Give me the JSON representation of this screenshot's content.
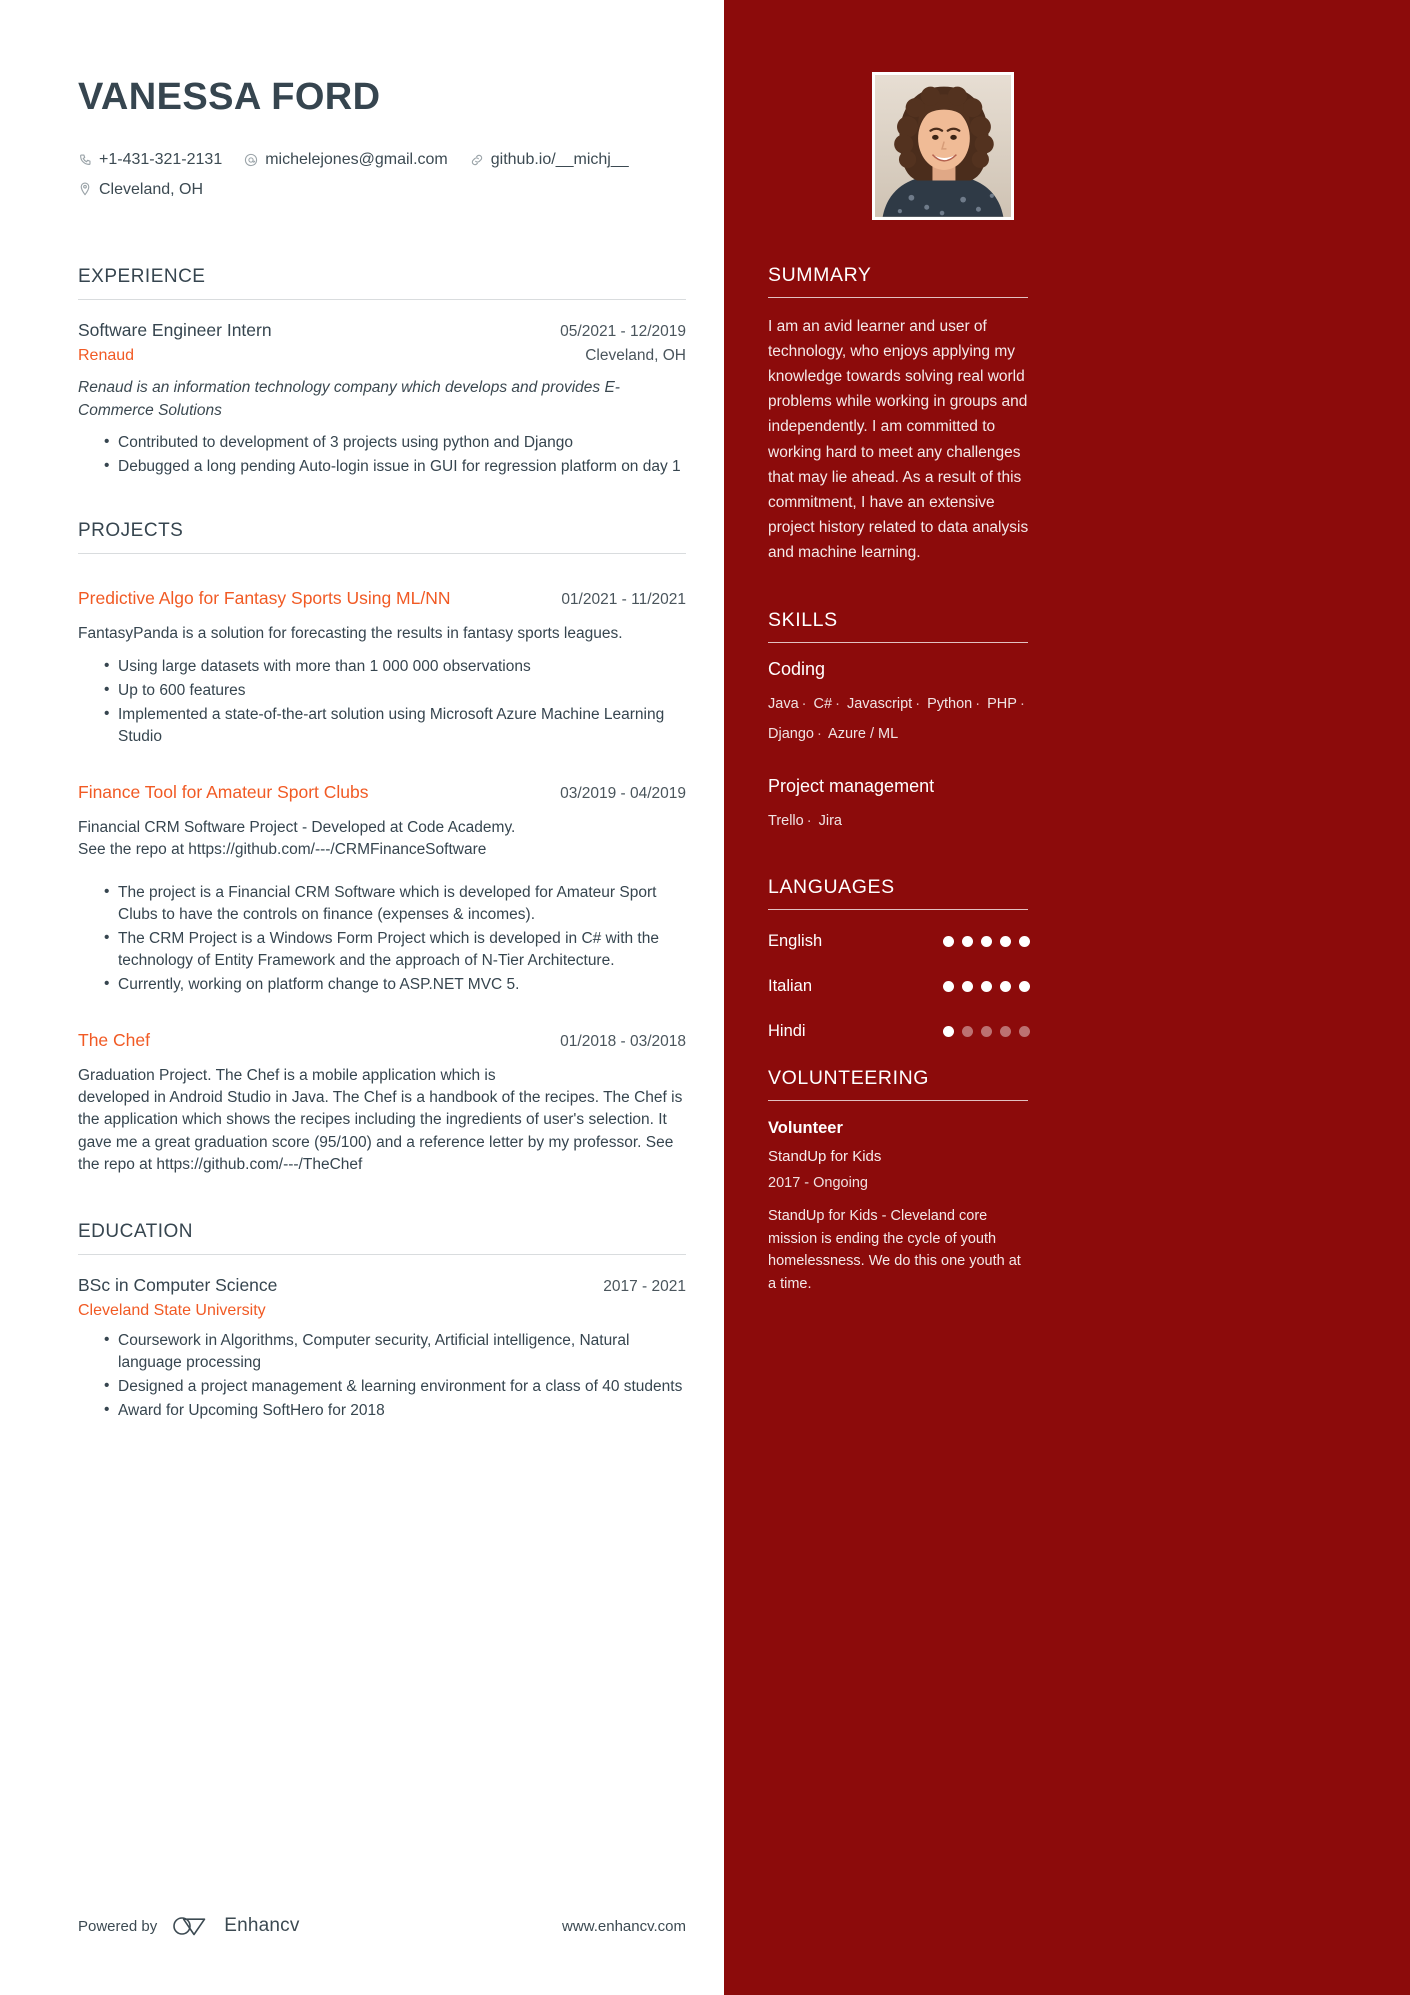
{
  "header": {
    "name": "VANESSA FORD",
    "contacts": [
      {
        "icon": "phone-icon",
        "text": "+1-431-321-2131"
      },
      {
        "icon": "email-icon",
        "text": "michelejones@gmail.com"
      },
      {
        "icon": "link-icon",
        "text": "github.io/__michj__"
      },
      {
        "icon": "location-icon",
        "text": "Cleveland, OH"
      }
    ]
  },
  "experience": {
    "heading": "EXPERIENCE",
    "entries": [
      {
        "title": "Software Engineer Intern",
        "date": "05/2021 - 12/2019",
        "company": "Renaud",
        "location": "Cleveland, OH",
        "summary": "Renaud is an information technology company which develops and provides E-Commerce Solutions",
        "bullets": [
          "Contributed to development of 3 projects using python and Django",
          "Debugged a long pending Auto-login issue in GUI for regression platform on day 1"
        ]
      }
    ]
  },
  "projects": {
    "heading": "PROJECTS",
    "entries": [
      {
        "title": "Predictive Algo for Fantasy Sports Using ML/NN",
        "date": "01/2021 - 11/2021",
        "description": "FantasyPanda is a solution for forecasting the results in fantasy sports leagues.",
        "bullets": [
          "Using large datasets with more than 1 000 000 observations",
          "Up to 600 features",
          "Implemented a state-of-the-art solution using Microsoft Azure Machine Learning Studio"
        ]
      },
      {
        "title": "Finance Tool for Amateur Sport Clubs",
        "date": "03/2019 - 04/2019",
        "description": "Financial CRM Software Project - Developed at Code Academy.\nSee the repo at https://github.com/---/CRMFinanceSoftware",
        "bullets": [
          "The project is a Financial CRM Software which is developed for Amateur Sport Clubs to have the controls on finance (expenses & incomes).",
          "The CRM Project is a Windows Form Project which is developed in C# with the technology of Entity Framework and the approach of N-Tier Architecture.",
          "Currently, working on platform change to ASP.NET MVC 5."
        ]
      },
      {
        "title": "The Chef",
        "date": "01/2018 - 03/2018",
        "description": "Graduation Project. The Chef is a mobile application which is\ndeveloped in Android Studio in Java. The Chef is a handbook of the recipes. The Chef is the application which shows the recipes including the ingredients of user's selection. It gave me a great graduation score (95/100) and a reference letter by my professor. See the repo at https://github.com/---/TheChef",
        "bullets": []
      }
    ]
  },
  "education": {
    "heading": "EDUCATION",
    "entries": [
      {
        "title": "BSc in Computer Science",
        "date": "2017 - 2021",
        "school": "Cleveland State University",
        "bullets": [
          "Coursework in Algorithms, Computer security, Artificial intelligence, Natural language processing",
          "Designed a project management & learning environment for a class of 40 students",
          "Award for Upcoming SoftHero for 2018"
        ]
      }
    ]
  },
  "sidebar": {
    "summary": {
      "heading": "SUMMARY",
      "text": "I am an avid learner and user of technology, who enjoys applying my knowledge towards solving real world problems while working in groups and independently. I am committed to working hard to meet any challenges that may lie ahead. As a result of this commitment, I have an extensive project history related to data analysis and machine learning."
    },
    "skills": {
      "heading": "SKILLS",
      "groups": [
        {
          "title": "Coding",
          "items": [
            "Java",
            "C#",
            "Javascript",
            "Python",
            "PHP",
            "Django",
            "Azure / ML"
          ]
        },
        {
          "title": "Project management",
          "items": [
            "Trello",
            "Jira"
          ]
        }
      ]
    },
    "languages": {
      "heading": "LANGUAGES",
      "items": [
        {
          "name": "English",
          "level": 5,
          "max": 5
        },
        {
          "name": "Italian",
          "level": 5,
          "max": 5
        },
        {
          "name": "Hindi",
          "level": 1,
          "max": 5
        }
      ]
    },
    "volunteering": {
      "heading": "VOLUNTEERING",
      "role": "Volunteer",
      "organization": "StandUp for Kids",
      "date": "2017 - Ongoing",
      "description": "StandUp for Kids - Cleveland core mission is ending the cycle of youth homelessness. We do this one youth at a time."
    }
  },
  "footer": {
    "powered_by": "Powered by",
    "brand": "Enhancv",
    "website": "www.enhancv.com"
  },
  "colors": {
    "sidebar_bg": "#8c0b0b",
    "accent": "#f15a24",
    "heading": "#36454f"
  }
}
